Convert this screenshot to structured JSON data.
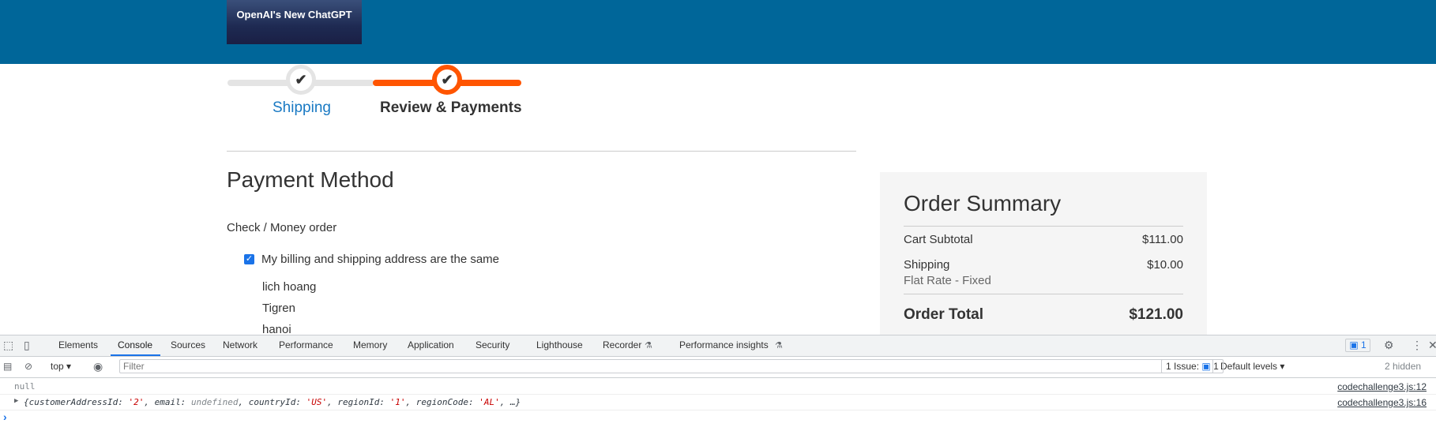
{
  "header": {
    "logo_text": "OpenAI's New ChatGPT"
  },
  "progress": {
    "steps": [
      {
        "label": "Shipping",
        "state": "completed"
      },
      {
        "label": "Review & Payments",
        "state": "active"
      }
    ]
  },
  "payment": {
    "title": "Payment Method",
    "option": "Check / Money order",
    "billing_same_label": "My billing and shipping address are the same",
    "billing_same_checked": true,
    "address": [
      "lich hoang",
      "Tigren",
      "hanoi"
    ]
  },
  "summary": {
    "title": "Order Summary",
    "subtotal_label": "Cart Subtotal",
    "subtotal_value": "$111.00",
    "shipping_label": "Shipping",
    "shipping_value": "$10.00",
    "shipping_method": "Flat Rate - Fixed",
    "total_label": "Order Total",
    "total_value": "$121.00"
  },
  "devtools": {
    "tabs": [
      "Elements",
      "Console",
      "Sources",
      "Network",
      "Performance",
      "Memory",
      "Application",
      "Security",
      "Lighthouse",
      "Recorder",
      "Performance insights"
    ],
    "active_tab": "Console",
    "message_count": "1",
    "context": "top",
    "filter_placeholder": "Filter",
    "levels": "Default levels",
    "issues_label": "1 Issue:",
    "issues_count": "1",
    "hidden": "2 hidden",
    "logs": [
      {
        "text": "null",
        "source": "codechallenge3.js:12"
      },
      {
        "source": "codechallenge3.js:16",
        "parts": [
          "{customerAddressId: ",
          "'2'",
          ", email: ",
          "undefined",
          ", countryId: ",
          "'US'",
          ", regionId: ",
          "'1'",
          ", regionCode: ",
          "'AL'",
          ", …}"
        ]
      }
    ]
  },
  "colors": {
    "header_bg": "#006699",
    "accent_orange": "#ff5501",
    "link_blue": "#1979c3"
  }
}
